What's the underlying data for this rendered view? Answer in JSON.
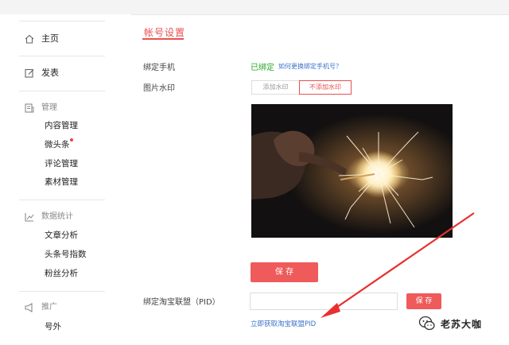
{
  "sidebar": {
    "home": "主页",
    "publish": "发表",
    "manage": {
      "title": "管理",
      "items": [
        "内容管理",
        "微头条",
        "评论管理",
        "素材管理"
      ]
    },
    "stats": {
      "title": "数据统计",
      "items": [
        "文章分析",
        "头条号指数",
        "粉丝分析"
      ]
    },
    "promote": {
      "title": "推广",
      "items": [
        "号外"
      ]
    }
  },
  "main": {
    "tab_title": "帐号设置",
    "phone": {
      "label": "绑定手机",
      "status": "已绑定",
      "change_link": "如何更换绑定手机号？"
    },
    "watermark": {
      "label": "图片水印",
      "options": [
        "添加水印",
        "不添加水印"
      ],
      "selected": "不添加水印"
    },
    "save_label": "保 存",
    "pid": {
      "label": "绑定淘宝联盟（PID）",
      "value": "",
      "save_label": "保 存",
      "get_link": "立即获取淘宝联盟PID"
    }
  },
  "watermark_overlay": {
    "account": "老苏大咖"
  },
  "colors": {
    "accent": "#e8504f",
    "success": "#26a626",
    "link": "#3a72c8",
    "button": "#ef5a5a"
  },
  "icons": [
    "home-icon",
    "edit-icon",
    "manage-icon",
    "stats-icon",
    "promote-icon",
    "wechat-logo-icon"
  ]
}
